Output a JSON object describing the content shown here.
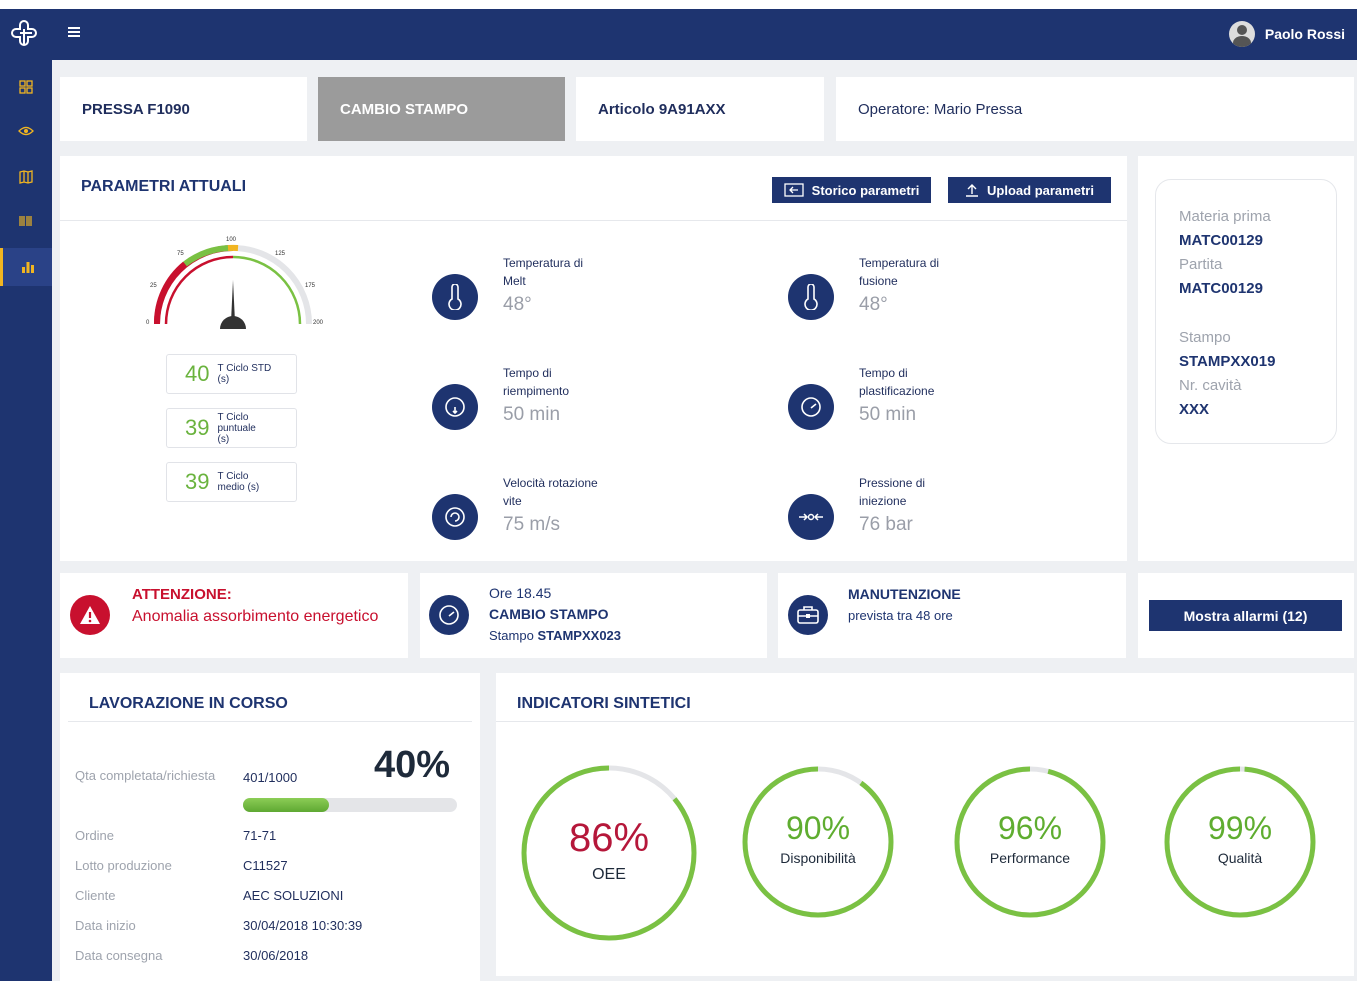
{
  "header": {
    "user_name": "Paolo Rossi"
  },
  "sidebar": {
    "items": [
      "dashboard-icon",
      "eye-icon",
      "map-icon",
      "barcode-icon",
      "bar-chart-icon"
    ]
  },
  "tabs": [
    {
      "label": "PRESSA F1090"
    },
    {
      "label": "CAMBIO STAMPO"
    },
    {
      "label": "Articolo 9A91AXX"
    },
    {
      "label": "Operatore: Mario Pressa"
    }
  ],
  "params": {
    "title": "PARAMETRI ATTUALI",
    "btn_history": "Storico parametri",
    "btn_upload": "Upload parametri",
    "gauge": {
      "ticks": [
        "0",
        "25",
        "75",
        "100",
        "125",
        "175",
        "200"
      ],
      "value": 100,
      "boxes": [
        {
          "num": "40",
          "label": "T Ciclo STD (s)"
        },
        {
          "num": "39",
          "label": "T Ciclo puntuale (s)"
        },
        {
          "num": "39",
          "label": "T Ciclo medio (s)"
        }
      ]
    },
    "items": [
      {
        "label": "Temperatura di Melt",
        "value": "48°",
        "icon": "thermometer-icon"
      },
      {
        "label": "Temperatura di fusione",
        "value": "48°",
        "icon": "thermometer-icon"
      },
      {
        "label": "Tempo di riempimento",
        "value": "50 min",
        "icon": "gauge-icon"
      },
      {
        "label": "Tempo di plastificazione",
        "value": "50 min",
        "icon": "gauge-icon"
      },
      {
        "label": "Velocità rotazione vite",
        "value": "75 m/s",
        "icon": "gauge-icon"
      },
      {
        "label": "Pressione di iniezione",
        "value": "76 bar",
        "icon": "pressure-icon"
      }
    ]
  },
  "material": {
    "materia_k": "Materia prima",
    "materia_v": "MATC00129",
    "partita_k": "Partita",
    "partita_v": "MATC00129",
    "stampo_k": "Stampo",
    "stampo_v": "STAMPXX019",
    "cavita_k": "Nr. cavità",
    "cavita_v": "XXX"
  },
  "alerts": {
    "warning_title": "ATTENZIONE:",
    "warning_text": "Anomalia assorbimento energetico",
    "change_time": "Ore 18.45",
    "change_title": "CAMBIO STAMPO",
    "change_mold_prefix": "Stampo",
    "change_mold": "STAMPXX023",
    "maint_title": "MANUTENZIONE",
    "maint_text": "prevista tra 48 ore",
    "show_alarms": "Mostra allarmi (12)"
  },
  "work": {
    "title": "LAVORAZIONE IN CORSO",
    "qty_k": "Qta completata/richiesta",
    "qty_v": "401/1000",
    "percent": "40%",
    "progress": 0.4,
    "rows": [
      {
        "k": "Ordine",
        "v": "71-71"
      },
      {
        "k": "Lotto produzione",
        "v": "C11527"
      },
      {
        "k": "Cliente",
        "v": "AEC SOLUZIONI"
      },
      {
        "k": "Data inizio",
        "v": "30/04/2018 10:30:39"
      },
      {
        "k": "Data consegna",
        "v": "30/06/2018"
      }
    ]
  },
  "indicators": {
    "title": "INDICATORI SINTETICI",
    "items": [
      {
        "value": "86%",
        "label": "OEE",
        "fraction": 0.86,
        "color": "#b5173a"
      },
      {
        "value": "90%",
        "label": "Disponibilità",
        "fraction": 0.9,
        "color": "#5fad30"
      },
      {
        "value": "96%",
        "label": "Performance",
        "fraction": 0.96,
        "color": "#5fad30"
      },
      {
        "value": "99%",
        "label": "Qualità",
        "fraction": 0.99,
        "color": "#5fad30"
      }
    ]
  },
  "colors": {
    "navy": "#1e3470",
    "green": "#7ac143",
    "red": "#c8102e",
    "accent": "#f1b521"
  }
}
